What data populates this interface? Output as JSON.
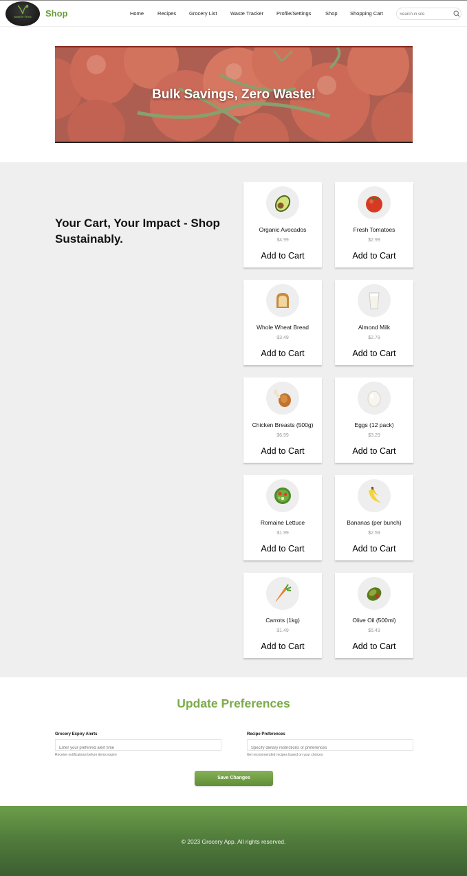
{
  "header": {
    "logo_text": "waste-less",
    "site_title": "Shop",
    "nav": [
      "Home",
      "Recipes",
      "Grocery List",
      "Waste Tracker",
      "Profile/Settings",
      "Shop",
      "Shopping Cart"
    ],
    "search_placeholder": "Search in site"
  },
  "hero": {
    "title": "Bulk Savings, Zero Waste!",
    "slides": 2,
    "active_slide": 1
  },
  "tagline": "Your Cart, Your Impact - Shop Sustainably.",
  "products": [
    {
      "name": "Organic Avocados",
      "price": "$4.99",
      "button": "Add to Cart",
      "icon": "avocado-icon"
    },
    {
      "name": "Fresh Tomatoes",
      "price": "$2.99",
      "button": "Add to Cart",
      "icon": "tomato-icon"
    },
    {
      "name": "Whole Wheat Bread",
      "price": "$3.49",
      "button": "Add to Cart",
      "icon": "bread-icon"
    },
    {
      "name": "Almond Milk",
      "price": "$2.79",
      "button": "Add to Cart",
      "icon": "milk-icon"
    },
    {
      "name": "Chicken Breasts (500g)",
      "price": "$6.99",
      "button": "Add to Cart",
      "icon": "chicken-icon"
    },
    {
      "name": "Eggs (12 pack)",
      "price": "$3.29",
      "button": "Add to Cart",
      "icon": "egg-icon"
    },
    {
      "name": "Romaine Lettuce",
      "price": "$1.99",
      "button": "Add to Cart",
      "icon": "salad-icon"
    },
    {
      "name": "Bananas (per bunch)",
      "price": "$2.59",
      "button": "Add to Cart",
      "icon": "banana-icon"
    },
    {
      "name": "Carrots (1kg)",
      "price": "$1.49",
      "button": "Add to Cart",
      "icon": "carrot-icon"
    },
    {
      "name": "Olive Oil (500ml)",
      "price": "$5.49",
      "button": "Add to Cart",
      "icon": "olive-icon"
    }
  ],
  "preferences": {
    "title": "Update Preferences",
    "expiry": {
      "label": "Grocery Expiry Alerts",
      "placeholder": "Enter your preferred alert time",
      "help": "Receive notifications before items expire"
    },
    "recipe": {
      "label": "Recipe Preferences",
      "placeholder": "Specify dietary restrictions or preferences",
      "help": "Get recommended recipes based on your choices"
    },
    "save_label": "Save Changes"
  },
  "footer": {
    "text": "© 2023 Grocery App. All rights reserved."
  },
  "colors": {
    "brand_green": "#6a9e3a",
    "title_green": "#7aab48",
    "section_bg": "#efefef"
  }
}
